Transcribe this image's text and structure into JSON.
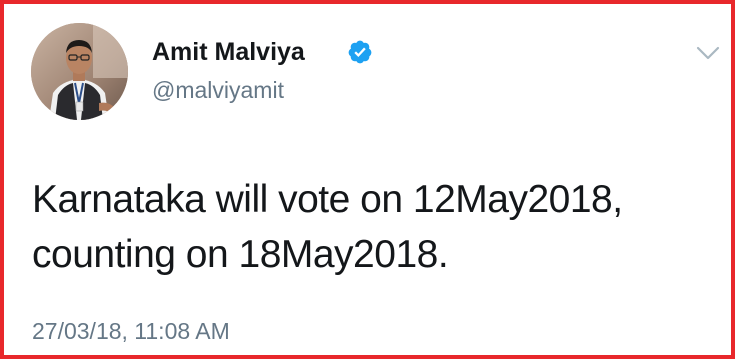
{
  "profile": {
    "display_name": "Amit Malviya",
    "handle": "@malviyamit",
    "verified": true,
    "avatar_icon": "profile-photo"
  },
  "menu": {
    "icon": "chevron-down-icon"
  },
  "tweet": {
    "lines": [
      "Karnataka will vote on 12May2018,",
      "counting on 18May2018."
    ],
    "timestamp": "27/03/18, 11:08 AM"
  },
  "colors": {
    "border": "#e8282b",
    "verified_badge": "#1da1f2",
    "text_primary": "#14171a",
    "text_secondary": "#657786"
  }
}
